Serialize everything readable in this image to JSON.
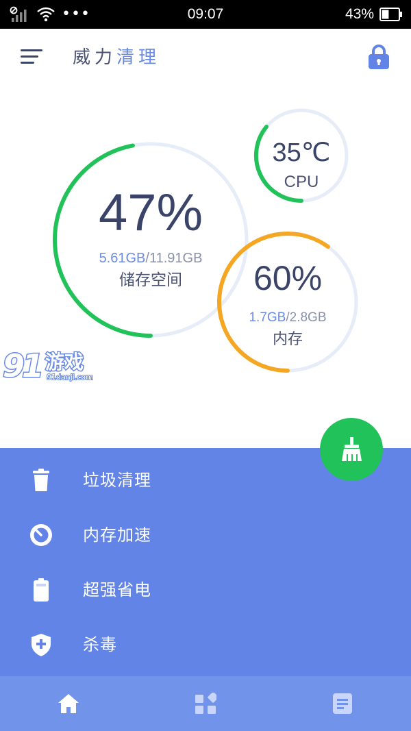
{
  "status_bar": {
    "time": "09:07",
    "battery_percent": "43%",
    "battery_level": 0.43,
    "overflow": "•••"
  },
  "app_bar": {
    "title_part1": "威力",
    "title_part2": "清理"
  },
  "gauges": {
    "storage": {
      "percent_text": "47%",
      "level": 0.47,
      "used": "5.61GB",
      "separator": "/",
      "total": "11.91GB",
      "label": "储存空间",
      "color": "#22c25a"
    },
    "cpu": {
      "temperature": "35℃",
      "label": "CPU",
      "color": "#22c25a"
    },
    "memory": {
      "percent_text": "60%",
      "level": 0.6,
      "used": "1.7GB",
      "separator": "/",
      "total": "2.8GB",
      "label": "内存",
      "color": "#f5a623"
    },
    "track_color": "#e6ecf8"
  },
  "watermark": {
    "brand": "游戏",
    "site": "91danji.com"
  },
  "menu": [
    {
      "label": "垃圾清理",
      "icon": "trash-icon"
    },
    {
      "label": "内存加速",
      "icon": "speedometer-icon"
    },
    {
      "label": "超强省电",
      "icon": "battery-icon"
    },
    {
      "label": "杀毒",
      "icon": "shield-plus-icon"
    }
  ],
  "bottom_nav": [
    {
      "icon": "home-icon",
      "active": true
    },
    {
      "icon": "apps-icon",
      "active": false
    },
    {
      "icon": "document-icon",
      "active": false
    }
  ],
  "colors": {
    "accent_blue": "#6284e6",
    "title_blue": "#6a8be5",
    "green": "#22c25a",
    "orange": "#f5a623",
    "nav_blue": "#7293ea"
  }
}
